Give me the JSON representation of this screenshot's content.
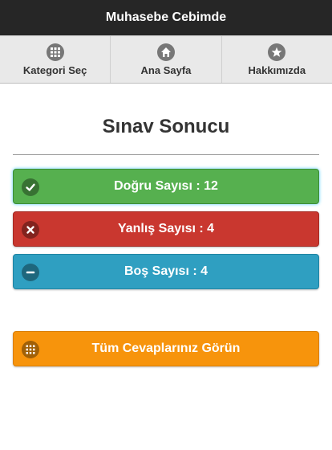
{
  "header": {
    "title": "Muhasebe Cebimde"
  },
  "nav": {
    "items": [
      {
        "label": "Kategori Seç",
        "icon": "grid-icon"
      },
      {
        "label": "Ana Sayfa",
        "icon": "home-icon"
      },
      {
        "label": "Hakkımızda",
        "icon": "star-icon"
      }
    ]
  },
  "page": {
    "title": "Sınav Sonucu"
  },
  "results": {
    "correct_label": "Doğru Sayısı : 12",
    "wrong_label": "Yanlış Sayısı : 4",
    "empty_label": "Boş Sayısı : 4",
    "show_all_label": "Tüm Cevaplarınız Görün"
  },
  "colors": {
    "header": "#262626",
    "correct": "#56b04f",
    "wrong": "#c9372f",
    "empty": "#2f9fc1",
    "show_all": "#f7940c"
  }
}
